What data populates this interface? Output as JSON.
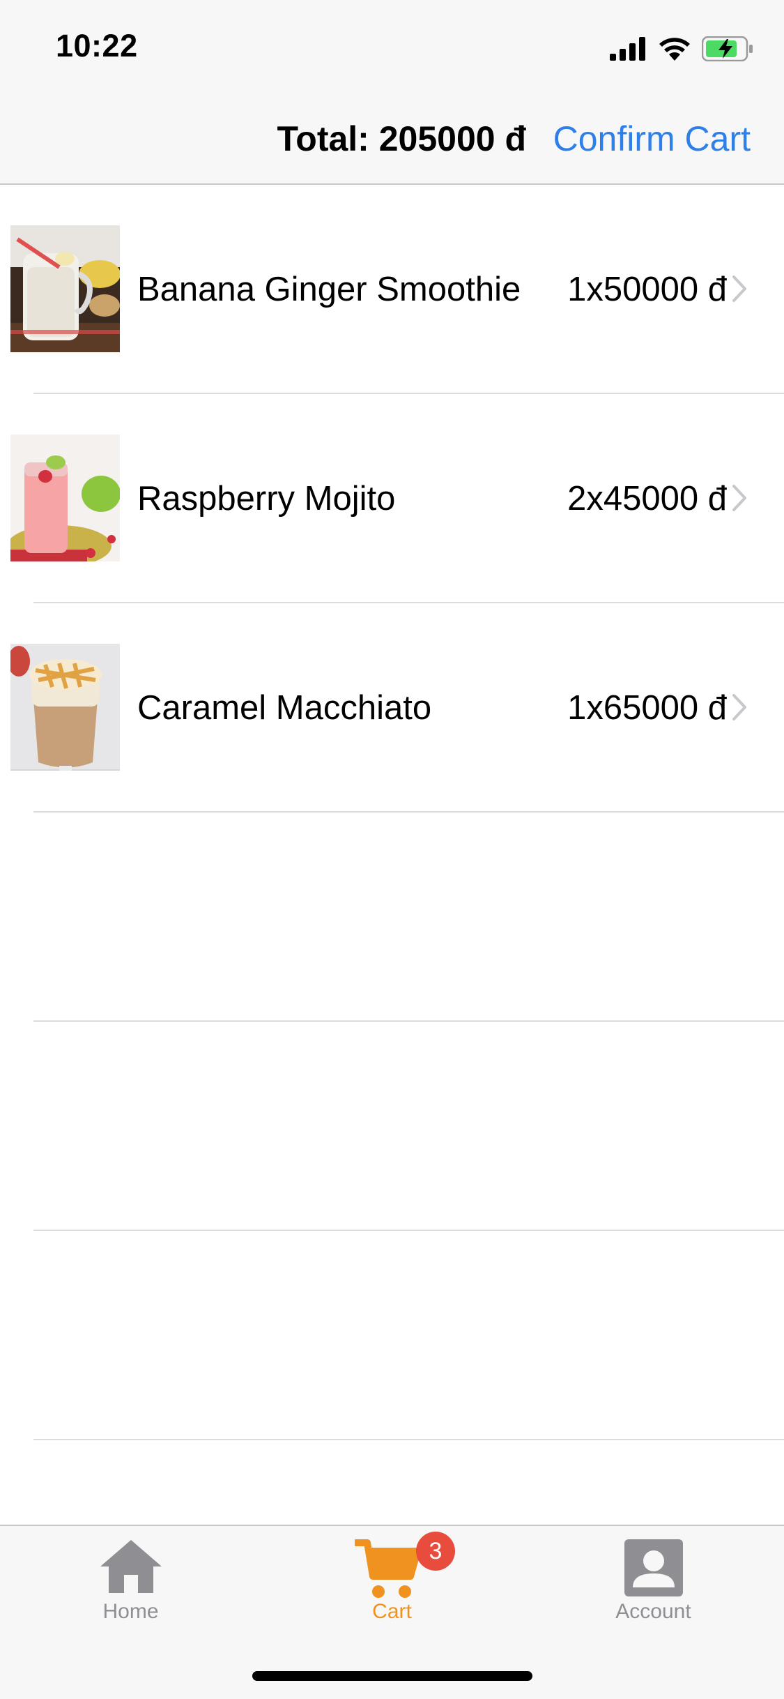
{
  "status_bar": {
    "time": "10:22"
  },
  "nav": {
    "total_label": "Total: 205000 đ",
    "confirm_label": "Confirm Cart"
  },
  "cart": {
    "items": [
      {
        "name": "Banana Ginger Smoothie",
        "qty_price": "1x50000 đ"
      },
      {
        "name": "Raspberry Mojito",
        "qty_price": "2x45000 đ"
      },
      {
        "name": "Caramel Macchiato",
        "qty_price": "1x65000 đ"
      }
    ]
  },
  "tabs": [
    {
      "label": "Home",
      "icon": "home-icon"
    },
    {
      "label": "Cart",
      "icon": "cart-icon",
      "badge": "3"
    },
    {
      "label": "Account",
      "icon": "account-icon"
    }
  ],
  "colors": {
    "accent": "#2f7fe8",
    "active_tab": "#f0921f",
    "inactive_tab": "#8e8e93",
    "badge": "#e84c3d"
  }
}
